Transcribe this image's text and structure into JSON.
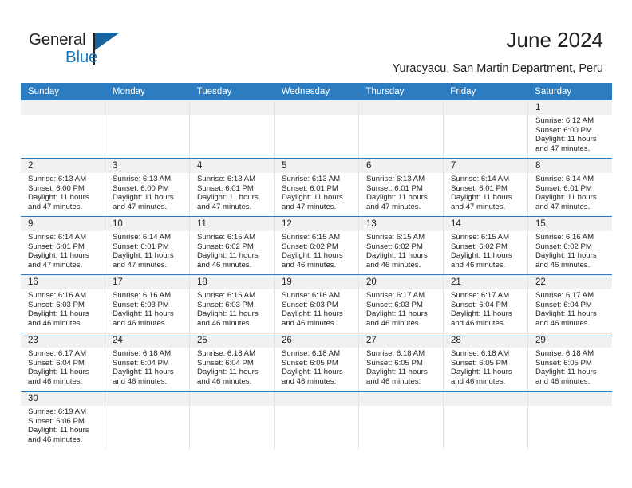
{
  "brand": {
    "name_part1": "General",
    "name_part2": "Blue",
    "accent_color": "#1878be",
    "flag_color": "#17649f"
  },
  "header": {
    "title": "June 2024",
    "subtitle": "Yuracyacu, San Martin Department, Peru"
  },
  "calendar": {
    "header_bg": "#2b7cc0",
    "daynum_bg": "#f1f1f1",
    "weekdays": [
      "Sunday",
      "Monday",
      "Tuesday",
      "Wednesday",
      "Thursday",
      "Friday",
      "Saturday"
    ],
    "weeks": [
      [
        {
          "day": "",
          "lines": []
        },
        {
          "day": "",
          "lines": []
        },
        {
          "day": "",
          "lines": []
        },
        {
          "day": "",
          "lines": []
        },
        {
          "day": "",
          "lines": []
        },
        {
          "day": "",
          "lines": []
        },
        {
          "day": "1",
          "lines": [
            "Sunrise: 6:12 AM",
            "Sunset: 6:00 PM",
            "Daylight: 11 hours",
            "and 47 minutes."
          ]
        }
      ],
      [
        {
          "day": "2",
          "lines": [
            "Sunrise: 6:13 AM",
            "Sunset: 6:00 PM",
            "Daylight: 11 hours",
            "and 47 minutes."
          ]
        },
        {
          "day": "3",
          "lines": [
            "Sunrise: 6:13 AM",
            "Sunset: 6:00 PM",
            "Daylight: 11 hours",
            "and 47 minutes."
          ]
        },
        {
          "day": "4",
          "lines": [
            "Sunrise: 6:13 AM",
            "Sunset: 6:01 PM",
            "Daylight: 11 hours",
            "and 47 minutes."
          ]
        },
        {
          "day": "5",
          "lines": [
            "Sunrise: 6:13 AM",
            "Sunset: 6:01 PM",
            "Daylight: 11 hours",
            "and 47 minutes."
          ]
        },
        {
          "day": "6",
          "lines": [
            "Sunrise: 6:13 AM",
            "Sunset: 6:01 PM",
            "Daylight: 11 hours",
            "and 47 minutes."
          ]
        },
        {
          "day": "7",
          "lines": [
            "Sunrise: 6:14 AM",
            "Sunset: 6:01 PM",
            "Daylight: 11 hours",
            "and 47 minutes."
          ]
        },
        {
          "day": "8",
          "lines": [
            "Sunrise: 6:14 AM",
            "Sunset: 6:01 PM",
            "Daylight: 11 hours",
            "and 47 minutes."
          ]
        }
      ],
      [
        {
          "day": "9",
          "lines": [
            "Sunrise: 6:14 AM",
            "Sunset: 6:01 PM",
            "Daylight: 11 hours",
            "and 47 minutes."
          ]
        },
        {
          "day": "10",
          "lines": [
            "Sunrise: 6:14 AM",
            "Sunset: 6:01 PM",
            "Daylight: 11 hours",
            "and 47 minutes."
          ]
        },
        {
          "day": "11",
          "lines": [
            "Sunrise: 6:15 AM",
            "Sunset: 6:02 PM",
            "Daylight: 11 hours",
            "and 46 minutes."
          ]
        },
        {
          "day": "12",
          "lines": [
            "Sunrise: 6:15 AM",
            "Sunset: 6:02 PM",
            "Daylight: 11 hours",
            "and 46 minutes."
          ]
        },
        {
          "day": "13",
          "lines": [
            "Sunrise: 6:15 AM",
            "Sunset: 6:02 PM",
            "Daylight: 11 hours",
            "and 46 minutes."
          ]
        },
        {
          "day": "14",
          "lines": [
            "Sunrise: 6:15 AM",
            "Sunset: 6:02 PM",
            "Daylight: 11 hours",
            "and 46 minutes."
          ]
        },
        {
          "day": "15",
          "lines": [
            "Sunrise: 6:16 AM",
            "Sunset: 6:02 PM",
            "Daylight: 11 hours",
            "and 46 minutes."
          ]
        }
      ],
      [
        {
          "day": "16",
          "lines": [
            "Sunrise: 6:16 AM",
            "Sunset: 6:03 PM",
            "Daylight: 11 hours",
            "and 46 minutes."
          ]
        },
        {
          "day": "17",
          "lines": [
            "Sunrise: 6:16 AM",
            "Sunset: 6:03 PM",
            "Daylight: 11 hours",
            "and 46 minutes."
          ]
        },
        {
          "day": "18",
          "lines": [
            "Sunrise: 6:16 AM",
            "Sunset: 6:03 PM",
            "Daylight: 11 hours",
            "and 46 minutes."
          ]
        },
        {
          "day": "19",
          "lines": [
            "Sunrise: 6:16 AM",
            "Sunset: 6:03 PM",
            "Daylight: 11 hours",
            "and 46 minutes."
          ]
        },
        {
          "day": "20",
          "lines": [
            "Sunrise: 6:17 AM",
            "Sunset: 6:03 PM",
            "Daylight: 11 hours",
            "and 46 minutes."
          ]
        },
        {
          "day": "21",
          "lines": [
            "Sunrise: 6:17 AM",
            "Sunset: 6:04 PM",
            "Daylight: 11 hours",
            "and 46 minutes."
          ]
        },
        {
          "day": "22",
          "lines": [
            "Sunrise: 6:17 AM",
            "Sunset: 6:04 PM",
            "Daylight: 11 hours",
            "and 46 minutes."
          ]
        }
      ],
      [
        {
          "day": "23",
          "lines": [
            "Sunrise: 6:17 AM",
            "Sunset: 6:04 PM",
            "Daylight: 11 hours",
            "and 46 minutes."
          ]
        },
        {
          "day": "24",
          "lines": [
            "Sunrise: 6:18 AM",
            "Sunset: 6:04 PM",
            "Daylight: 11 hours",
            "and 46 minutes."
          ]
        },
        {
          "day": "25",
          "lines": [
            "Sunrise: 6:18 AM",
            "Sunset: 6:04 PM",
            "Daylight: 11 hours",
            "and 46 minutes."
          ]
        },
        {
          "day": "26",
          "lines": [
            "Sunrise: 6:18 AM",
            "Sunset: 6:05 PM",
            "Daylight: 11 hours",
            "and 46 minutes."
          ]
        },
        {
          "day": "27",
          "lines": [
            "Sunrise: 6:18 AM",
            "Sunset: 6:05 PM",
            "Daylight: 11 hours",
            "and 46 minutes."
          ]
        },
        {
          "day": "28",
          "lines": [
            "Sunrise: 6:18 AM",
            "Sunset: 6:05 PM",
            "Daylight: 11 hours",
            "and 46 minutes."
          ]
        },
        {
          "day": "29",
          "lines": [
            "Sunrise: 6:18 AM",
            "Sunset: 6:05 PM",
            "Daylight: 11 hours",
            "and 46 minutes."
          ]
        }
      ],
      [
        {
          "day": "30",
          "lines": [
            "Sunrise: 6:19 AM",
            "Sunset: 6:06 PM",
            "Daylight: 11 hours",
            "and 46 minutes."
          ]
        },
        {
          "day": "",
          "lines": []
        },
        {
          "day": "",
          "lines": []
        },
        {
          "day": "",
          "lines": []
        },
        {
          "day": "",
          "lines": []
        },
        {
          "day": "",
          "lines": []
        },
        {
          "day": "",
          "lines": []
        }
      ]
    ]
  }
}
